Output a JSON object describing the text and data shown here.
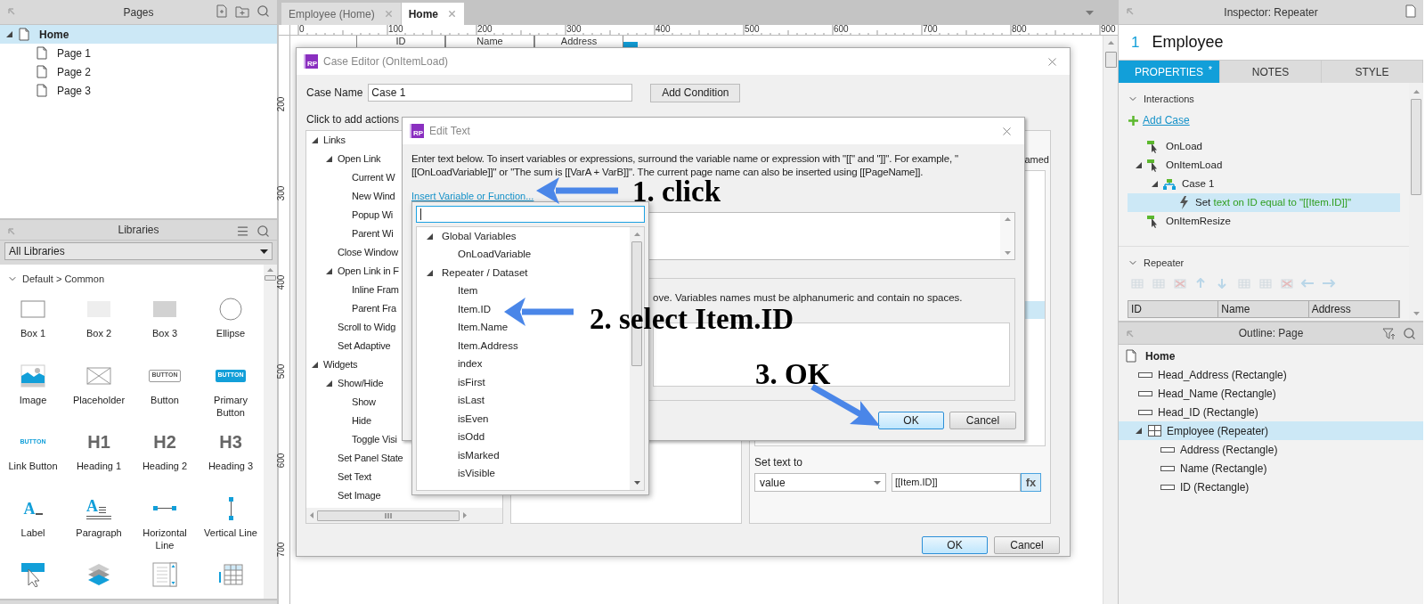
{
  "pages_panel": {
    "title": "Pages",
    "tree": [
      {
        "label": "Home",
        "selected": true,
        "expanded": true,
        "children": [
          {
            "label": "Page 1",
            "selected": false
          },
          {
            "label": "Page 2",
            "selected": false
          },
          {
            "label": "Page 3",
            "selected": false
          }
        ]
      }
    ]
  },
  "libraries_panel": {
    "title": "Libraries",
    "library": "All Libraries",
    "section": "Default > Common",
    "section_expanded": true,
    "widgets": [
      {
        "kind": "box1",
        "label": "Box 1"
      },
      {
        "kind": "box2",
        "label": "Box 2"
      },
      {
        "kind": "box3",
        "label": "Box 3"
      },
      {
        "kind": "ellipse",
        "label": "Ellipse"
      },
      {
        "kind": "image",
        "label": "Image"
      },
      {
        "kind": "placeholder",
        "label": "Placeholder"
      },
      {
        "kind": "button",
        "label": "Button",
        "icon_text": "BUTTON"
      },
      {
        "kind": "primary_button",
        "label": "Primary Button",
        "icon_text": "BUTTON"
      },
      {
        "kind": "link_button",
        "label": "Link Button",
        "icon_text": "BUTTON"
      },
      {
        "kind": "heading",
        "label": "Heading 1",
        "icon_text": "H1"
      },
      {
        "kind": "heading",
        "label": "Heading 2",
        "icon_text": "H2"
      },
      {
        "kind": "heading",
        "label": "Heading 3",
        "icon_text": "H3"
      },
      {
        "kind": "label",
        "label": "Label",
        "icon_text": "A"
      },
      {
        "kind": "paragraph",
        "label": "Paragraph",
        "icon_text": "A"
      },
      {
        "kind": "hline",
        "label": "Horizontal Line"
      },
      {
        "kind": "vline",
        "label": "Vertical Line"
      },
      {
        "kind": "hotspot"
      },
      {
        "kind": "dynamic_panel"
      },
      {
        "kind": "list"
      },
      {
        "kind": "table"
      }
    ]
  },
  "document_tabs": [
    {
      "label": "Employee (Home)",
      "selected": false
    },
    {
      "label": "Home",
      "selected": true
    }
  ],
  "ruler": {
    "horizontal": [
      "0",
      "100",
      "200",
      "300",
      "400",
      "500",
      "600",
      "700",
      "800",
      "900"
    ],
    "vertical": [
      "200",
      "300",
      "400",
      "500",
      "600",
      "700"
    ]
  },
  "canvas": {
    "column_headers": [
      "ID",
      "Name",
      "Address"
    ]
  },
  "case_editor": {
    "title": "Case Editor (OnItemLoad)",
    "logo_text": "RP",
    "case_name_label": "Case Name",
    "case_name": "Case 1",
    "add_condition": "Add Condition",
    "actions_label": "Click to add actions",
    "actions_tree": [
      {
        "label": "Links",
        "expanded": true,
        "children": [
          {
            "label": "Open Link",
            "expanded": true,
            "children": [
              {
                "label": "Current W"
              },
              {
                "label": "New Wind"
              },
              {
                "label": "Popup Wi"
              },
              {
                "label": "Parent Wi"
              }
            ]
          },
          {
            "label": "Close Window"
          },
          {
            "label": "Open Link in F",
            "expanded": true,
            "children": [
              {
                "label": "Inline Fram"
              },
              {
                "label": "Parent Fra"
              }
            ]
          },
          {
            "label": "Scroll to Widg"
          },
          {
            "label": "Set Adaptive"
          }
        ]
      },
      {
        "label": "Widgets",
        "expanded": true,
        "children": [
          {
            "label": "Show/Hide",
            "expanded": true,
            "children": [
              {
                "label": "Show"
              },
              {
                "label": "Hide"
              },
              {
                "label": "Toggle Visi"
              }
            ]
          },
          {
            "label": "Set Panel State"
          },
          {
            "label": "Set Text"
          },
          {
            "label": "Set Image"
          }
        ]
      }
    ],
    "config_label_fragment": "amed",
    "set_text_label": "Set text to",
    "set_text_type": "value",
    "set_text_value": "[[Item.ID]]",
    "fx_button": "fx",
    "buttons": [
      {
        "label": "OK",
        "default": true
      },
      {
        "label": "Cancel",
        "default": false
      }
    ]
  },
  "edit_text": {
    "title": "Edit Text",
    "logo_text": "RP",
    "instructions": "Enter text below. To insert variables or expressions, surround the variable name or expression with \"[[\" and \"]]\". For example, \"[[OnLoadVariable]]\" or \"The sum is [[VarA + VarB]]\". The current page name can also be inserted using [[PageName]].",
    "insert_link": "Insert Variable or Function...",
    "local_variables_note": "ove. Variables names must be alphanumeric and contain no spaces.",
    "buttons": [
      {
        "label": "OK",
        "default": true
      },
      {
        "label": "Cancel",
        "default": false
      }
    ]
  },
  "variable_dropdown": {
    "tree": [
      {
        "label": "Global Variables",
        "expanded": true,
        "children": [
          {
            "label": "OnLoadVariable"
          }
        ]
      },
      {
        "label": "Repeater / Dataset",
        "expanded": true,
        "children": [
          {
            "label": "Item"
          },
          {
            "label": "Item.ID"
          },
          {
            "label": "Item.Name"
          },
          {
            "label": "Item.Address"
          },
          {
            "label": "index"
          },
          {
            "label": "isFirst"
          },
          {
            "label": "isLast"
          },
          {
            "label": "isEven"
          },
          {
            "label": "isOdd"
          },
          {
            "label": "isMarked"
          },
          {
            "label": "isVisible"
          }
        ]
      }
    ]
  },
  "inspector": {
    "title": "Inspector: Repeater",
    "widget_number": "1",
    "widget_name": "Employee",
    "tabs": [
      {
        "label": "PROPERTIES",
        "selected": true,
        "badge": "*"
      },
      {
        "label": "NOTES",
        "selected": false
      },
      {
        "label": "STYLE",
        "selected": false
      }
    ],
    "interactions": {
      "title": "Interactions",
      "expanded": true,
      "add_case": "Add Case",
      "events": [
        {
          "kind": "event",
          "label": "OnLoad",
          "selected": false
        },
        {
          "kind": "event",
          "label": "OnItemLoad",
          "selected": false,
          "expanded": true,
          "children": [
            {
              "kind": "case",
              "label": "Case 1",
              "selected": false,
              "expanded": true,
              "children": [
                {
                  "kind": "action",
                  "verb": "Set",
                  "detail": "text on ID equal to \"[[Item.ID]]\"",
                  "selected": true
                }
              ]
            }
          ]
        },
        {
          "kind": "event",
          "label": "OnItemResize",
          "selected": false
        }
      ]
    },
    "repeater": {
      "title": "Repeater",
      "expanded": true,
      "columns": [
        "ID",
        "Name",
        "Address"
      ]
    }
  },
  "outline": {
    "title": "Outline: Page",
    "tree": [
      {
        "kind": "page",
        "label": "Home",
        "selected": false,
        "children": [
          {
            "kind": "rectangle",
            "label": "Head_Address (Rectangle)",
            "selected": false
          },
          {
            "kind": "rectangle",
            "label": "Head_Name (Rectangle)",
            "selected": false
          },
          {
            "kind": "rectangle",
            "label": "Head_ID (Rectangle)",
            "selected": false
          },
          {
            "kind": "repeater",
            "label": "Employee (Repeater)",
            "selected": true,
            "expanded": true,
            "children": [
              {
                "kind": "rectangle",
                "label": "Address (Rectangle)",
                "selected": false
              },
              {
                "kind": "rectangle",
                "label": "Name (Rectangle)",
                "selected": false
              },
              {
                "kind": "rectangle",
                "label": "ID (Rectangle)",
                "selected": false
              }
            ]
          }
        ]
      }
    ]
  },
  "annotations": [
    {
      "text": "1. click"
    },
    {
      "text": "2. select Item.ID"
    },
    {
      "text": "3. OK"
    }
  ]
}
